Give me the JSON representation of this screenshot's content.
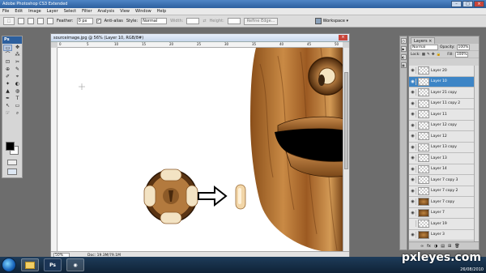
{
  "app": {
    "title": "Adobe Photoshop CS3 Extended",
    "window_controls": [
      "–",
      "□",
      "×"
    ]
  },
  "menu": [
    "File",
    "Edit",
    "Image",
    "Layer",
    "Select",
    "Filter",
    "Analysis",
    "View",
    "Window",
    "Help"
  ],
  "options_bar": {
    "feather_label": "Feather:",
    "feather_value": "0 px",
    "antialias_label": "Anti-alias",
    "style_label": "Style:",
    "style_value": "Normal",
    "width_label": "Width:",
    "height_label": "Height:",
    "refine_edge": "Refine Edge...",
    "workspace": "Workspace ▾"
  },
  "toolbox": {
    "logo": "Ps",
    "tools": [
      "▭",
      "✥",
      "⌒",
      "⁂",
      "⊡",
      "✂",
      "⊕",
      "✎",
      "✐",
      "⌖",
      "✦",
      "◐",
      "▲",
      "◍",
      "✒",
      "T",
      "↖",
      "▭",
      "☞",
      "⌕"
    ]
  },
  "document": {
    "title": "sourceimage.jpg @ 56% (Layer 10, RGB/8#)",
    "close": "×",
    "zoom": "50%",
    "doc_size": "Doc: 19.3M/79.1M",
    "ruler_ticks": [
      "0",
      "5",
      "10",
      "15",
      "20",
      "25",
      "30",
      "35",
      "40",
      "45",
      "50"
    ]
  },
  "layers_panel": {
    "tab": "Layers ×",
    "blend_mode": "Normal",
    "opacity_label": "Opacity:",
    "opacity_value": "100%",
    "lock_label": "Lock:",
    "fill_label": "Fill:",
    "fill_value": "100%",
    "layers": [
      {
        "name": "Layer 20",
        "visible": true,
        "selected": false,
        "wood": false
      },
      {
        "name": "Layer 10",
        "visible": true,
        "selected": true,
        "wood": false
      },
      {
        "name": "Layer 21 copy",
        "visible": true,
        "selected": false,
        "wood": false
      },
      {
        "name": "Layer 11 copy 2",
        "visible": true,
        "selected": false,
        "wood": false
      },
      {
        "name": "Layer 11",
        "visible": true,
        "selected": false,
        "wood": false
      },
      {
        "name": "Layer 12 copy",
        "visible": true,
        "selected": false,
        "wood": false
      },
      {
        "name": "Layer 12",
        "visible": true,
        "selected": false,
        "wood": false
      },
      {
        "name": "Layer 13 copy",
        "visible": true,
        "selected": false,
        "wood": false
      },
      {
        "name": "Layer 13",
        "visible": true,
        "selected": false,
        "wood": false
      },
      {
        "name": "Layer 14",
        "visible": true,
        "selected": false,
        "wood": false
      },
      {
        "name": "Layer 7 copy 3",
        "visible": true,
        "selected": false,
        "wood": false
      },
      {
        "name": "Layer 7 copy 2",
        "visible": true,
        "selected": false,
        "wood": false
      },
      {
        "name": "Layer 7 copy",
        "visible": true,
        "selected": false,
        "wood": true
      },
      {
        "name": "Layer 7",
        "visible": true,
        "selected": false,
        "wood": true
      },
      {
        "name": "Layer 19",
        "visible": false,
        "selected": false,
        "wood": false
      },
      {
        "name": "Layer 3",
        "visible": true,
        "selected": false,
        "wood": true
      }
    ],
    "footer_icons": [
      "∞",
      "fx",
      "◑",
      "▤",
      "⊞",
      "🗑"
    ]
  },
  "taskbar": {
    "start": "",
    "tasks": [
      "folder",
      "Ps",
      "disk"
    ],
    "clock": "26/08/2010"
  },
  "watermark": "pxleyes.com",
  "colors": {
    "titlebar": "#2c5f9e",
    "selected_layer": "#3d85c6",
    "wood": "#b5742f"
  }
}
